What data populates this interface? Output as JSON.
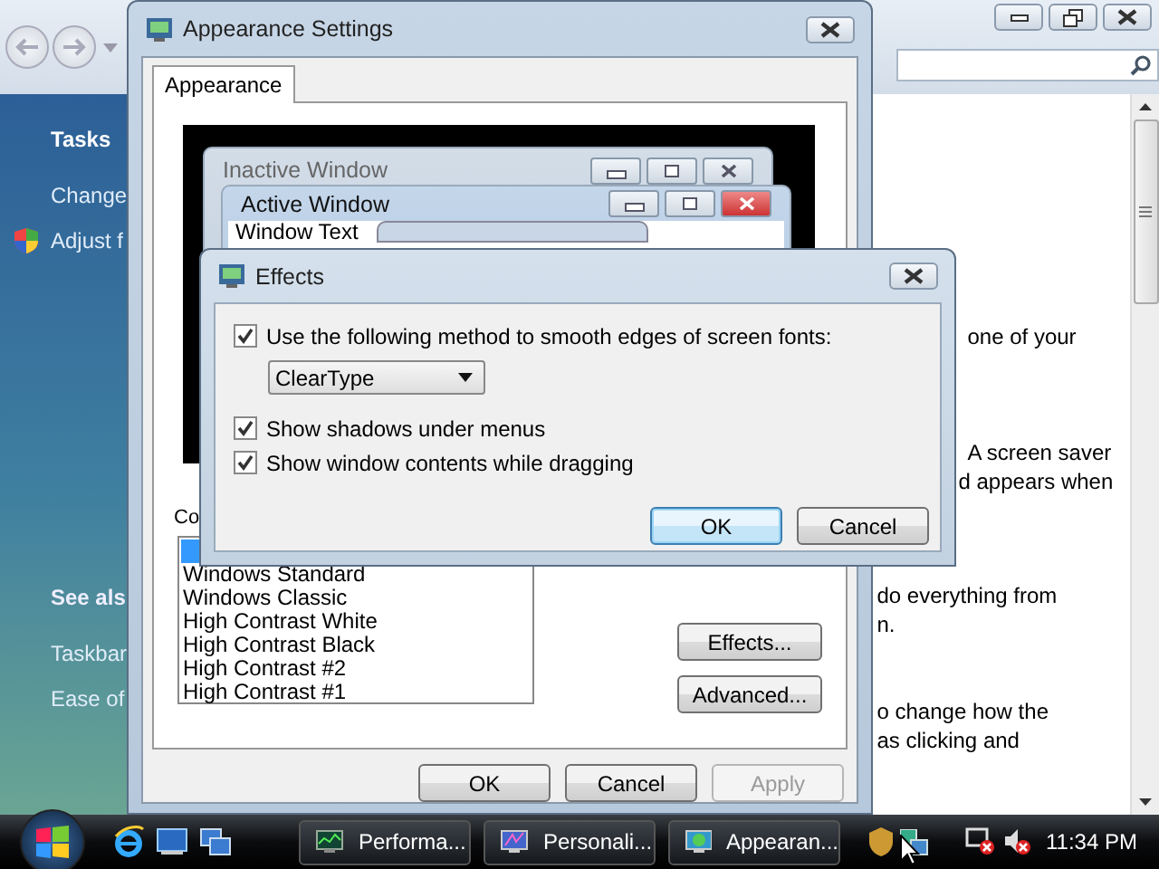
{
  "background_window": {
    "sidebar": {
      "tasks_heading": "Tasks",
      "tasks": [
        {
          "label": "Change",
          "kind": "plain"
        },
        {
          "label": "Adjust f",
          "kind": "shield"
        }
      ],
      "see_also_heading": "See als",
      "see_also": [
        "Taskbar",
        "Ease of"
      ]
    },
    "content_paragraphs": [
      [
        "one of your"
      ],
      [
        "A screen saver",
        "d appears when"
      ],
      [
        "do everything from",
        "n."
      ],
      [
        "o change how the",
        "as clicking and"
      ]
    ]
  },
  "appearance_window": {
    "title": "Appearance Settings",
    "tabs": [
      {
        "label": "Appearance",
        "selected": true
      }
    ],
    "preview": {
      "inactive_title": "Inactive Window",
      "active_title": "Active Window",
      "window_text": "Window Text"
    },
    "color_scheme_label": "Co",
    "color_schemes": [
      {
        "selected": true
      },
      {
        "label": "Windows Standard",
        "selected": false
      },
      {
        "label": "Windows Classic",
        "selected": false
      },
      {
        "label": "High Contrast White",
        "selected": false
      },
      {
        "label": "High Contrast Black",
        "selected": false
      },
      {
        "label": "High Contrast #2",
        "selected": false
      },
      {
        "label": "High Contrast #1",
        "selected": false
      }
    ],
    "side_buttons": [
      "Effects...",
      "Advanced..."
    ],
    "buttons": [
      {
        "label": "OK",
        "disabled": false
      },
      {
        "label": "Cancel",
        "disabled": false
      },
      {
        "label": "Apply",
        "disabled": true
      }
    ]
  },
  "effects_dialog": {
    "title": "Effects",
    "options": [
      {
        "kind": "checkbox",
        "label": "Use the following method to smooth edges of screen fonts:",
        "checked": true
      },
      {
        "kind": "dropdown",
        "value": "ClearType"
      },
      {
        "kind": "checkbox",
        "label": "Show shadows under menus",
        "checked": true
      },
      {
        "kind": "checkbox",
        "label": "Show window contents while dragging",
        "checked": true
      }
    ],
    "buttons": [
      {
        "label": "OK",
        "default": true
      },
      {
        "label": "Cancel",
        "default": false
      }
    ]
  },
  "taskbar": {
    "tasks": [
      {
        "label": "Performa...",
        "kind": "monitor"
      },
      {
        "label": "Personali...",
        "kind": "display"
      },
      {
        "label": "Appearan...",
        "kind": "globe"
      }
    ],
    "clock": "11:34 PM"
  }
}
